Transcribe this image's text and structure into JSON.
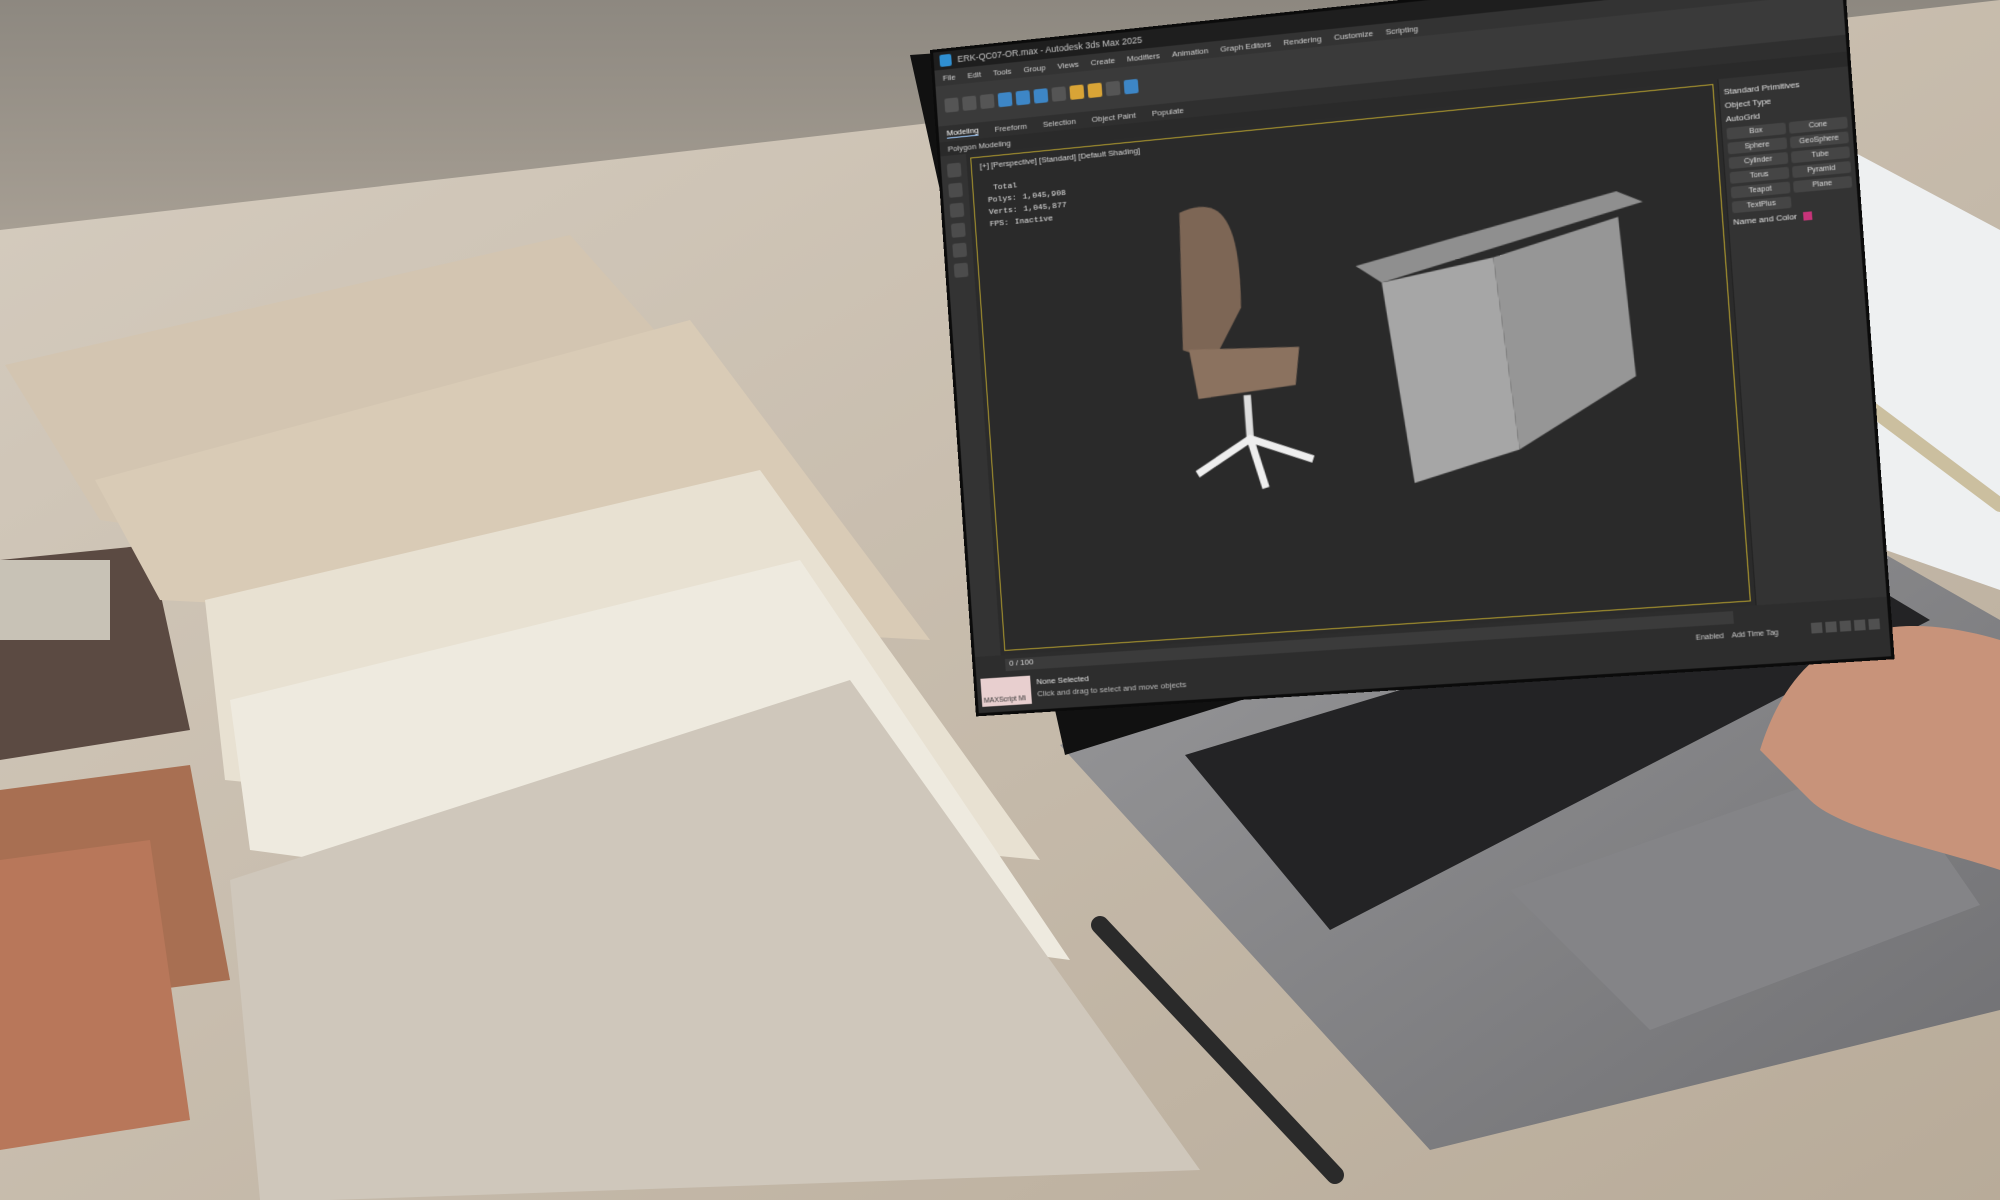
{
  "app": {
    "title": "ERK-QC07-OR.max - Autodesk 3ds Max 2025",
    "menu": [
      "File",
      "Edit",
      "Tools",
      "Group",
      "Views",
      "Create",
      "Modifiers",
      "Animation",
      "Graph Editors",
      "Rendering",
      "Customize",
      "Scripting"
    ],
    "ribbon_tabs": [
      "Modeling",
      "Freeform",
      "Selection",
      "Object Paint",
      "Populate"
    ],
    "active_tab": "Modeling",
    "ribbon_sub": "Polygon Modeling"
  },
  "viewport": {
    "label": "[+] [Perspective] [Standard] [Default Shading]",
    "stats": [
      {
        "k": "",
        "v": "Total"
      },
      {
        "k": "Polys:",
        "v": "1,045,908"
      },
      {
        "k": "Verts:",
        "v": "1,045,877"
      },
      {
        "k": "FPS:",
        "v": "Inactive"
      }
    ]
  },
  "command_panel": {
    "header": "Standard Primitives",
    "object_type": "Object Type",
    "autogrid": "AutoGrid",
    "buttons": [
      "Box",
      "Cone",
      "Sphere",
      "GeoSphere",
      "Cylinder",
      "Tube",
      "Torus",
      "Pyramid",
      "Teapot",
      "Plane",
      "TextPlus"
    ],
    "name_color": "Name and Color"
  },
  "statusbar": {
    "frame": "0 / 100",
    "selection": "None Selected",
    "hint": "Click and drag to select and move objects",
    "maxscript": "MAXScript Mi",
    "enabled": "Enabled",
    "add_time_tag": "Add Time Tag"
  }
}
